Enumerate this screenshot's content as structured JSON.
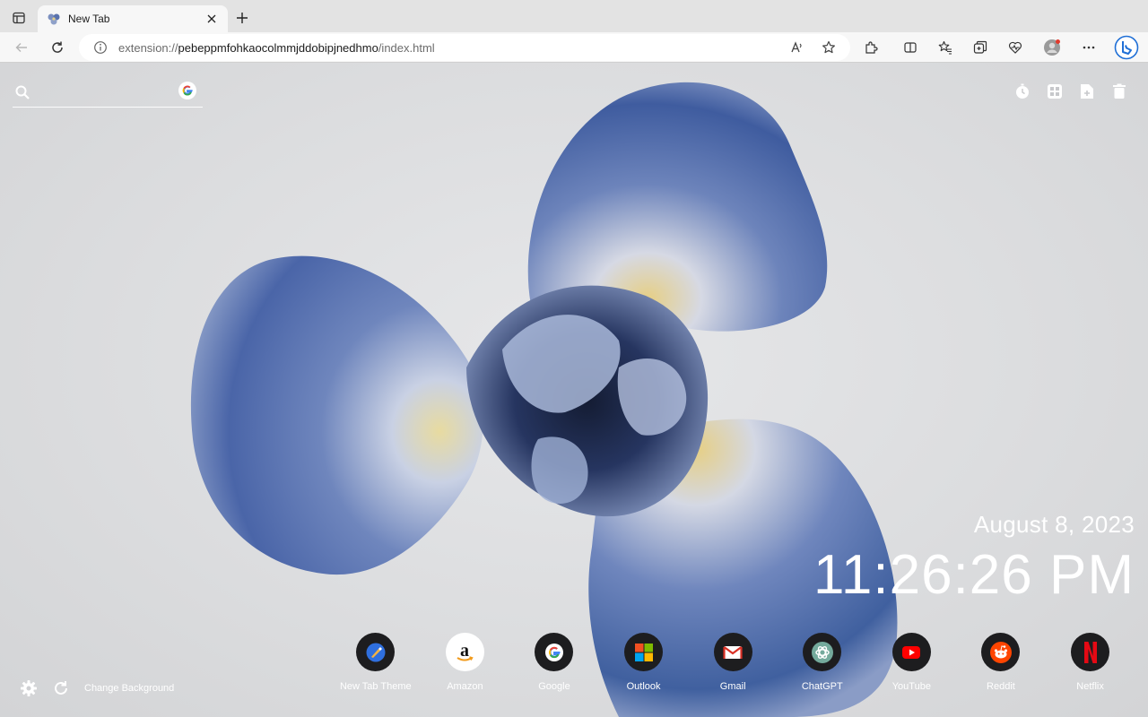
{
  "browser": {
    "tab": {
      "title": "New Tab"
    },
    "address": {
      "scheme": "extension://",
      "host": "pebeppmfohkaocolmmjddobipjnedhmo",
      "path": "/index.html"
    }
  },
  "page": {
    "search": {
      "placeholder": ""
    },
    "date": "August 8, 2023",
    "time": "11:26:26 PM",
    "dock": [
      {
        "label": "New Tab Theme",
        "icon": "new-tab-theme-icon"
      },
      {
        "label": "Amazon",
        "icon": "amazon-icon"
      },
      {
        "label": "Google",
        "icon": "google-icon"
      },
      {
        "label": "Outlook",
        "icon": "outlook-icon"
      },
      {
        "label": "Gmail",
        "icon": "gmail-icon"
      },
      {
        "label": "ChatGPT",
        "icon": "chatgpt-icon"
      },
      {
        "label": "YouTube",
        "icon": "youtube-icon"
      },
      {
        "label": "Reddit",
        "icon": "reddit-icon"
      },
      {
        "label": "Netflix",
        "icon": "netflix-icon"
      }
    ],
    "change_background_label": "Change Background"
  },
  "colors": {
    "flower_blue": "#3d5a9e",
    "flower_light": "#a7b6d6",
    "flower_yellow": "#e3cf8a",
    "dock_circle": "#1d1d1f"
  }
}
